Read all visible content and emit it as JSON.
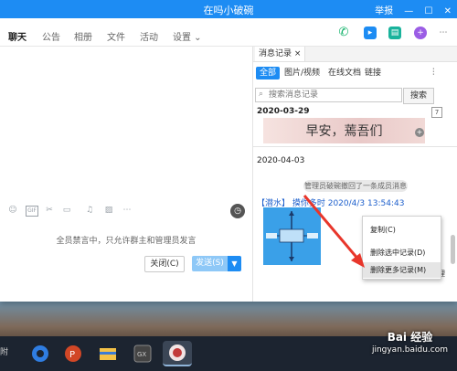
{
  "window": {
    "title": "在吗小破碗",
    "controls": [
      "举报",
      "—",
      "☐",
      "✕"
    ]
  },
  "tabs": [
    {
      "label": "聊天",
      "active": true
    },
    {
      "label": "公告"
    },
    {
      "label": "相册"
    },
    {
      "label": "文件"
    },
    {
      "label": "活动"
    },
    {
      "label": "设置 ⌄"
    }
  ],
  "top_icons": [
    "phone-icon",
    "video-icon",
    "screen-share-icon",
    "apps-icon",
    "more-icon"
  ],
  "chat": {
    "mute_notice": "全员禁言中，只允许群主和管理员发言",
    "close_label": "关闭(C)",
    "send_label": "发送(S)"
  },
  "toolbar_icons": [
    "emoji-icon",
    "gif-icon",
    "scissors-icon",
    "folder-icon",
    "music-icon",
    "image-icon",
    "more-icon",
    "history-icon"
  ],
  "record": {
    "tab_label": "消息记录 ×",
    "filters": [
      "全部",
      "图片/视频",
      "在线文档",
      "链接"
    ],
    "search_placeholder": "搜索消息记录",
    "search_button": "搜索",
    "date_1": "2020-03-29",
    "date_badge": "7",
    "sticker_text": "早安，蔫吾们",
    "date_2": "2020-04-03",
    "system_message": "管理员破碗撤回了一条成员消息",
    "message_header": "【潜水】 摸你多时 2020/4/3 13:54:43",
    "behind_text": "理"
  },
  "context_menu": {
    "items": [
      {
        "label": "复制(C)",
        "highlighted": false
      },
      {
        "label": "删除选中记录(D)",
        "highlighted": false
      },
      {
        "label": "删除更多记录(M)",
        "highlighted": true
      }
    ]
  },
  "taskbar": {
    "apps": [
      "edge-icon",
      "powerpoint-icon",
      "explorer-icon",
      "gpu-icon",
      "group-avatar-icon"
    ]
  },
  "watermark": {
    "title": "Bai 经验",
    "url": "jingyan.baidu.com"
  },
  "colors": {
    "accent": "#1d8cf3",
    "arrow": "#e8362b"
  }
}
